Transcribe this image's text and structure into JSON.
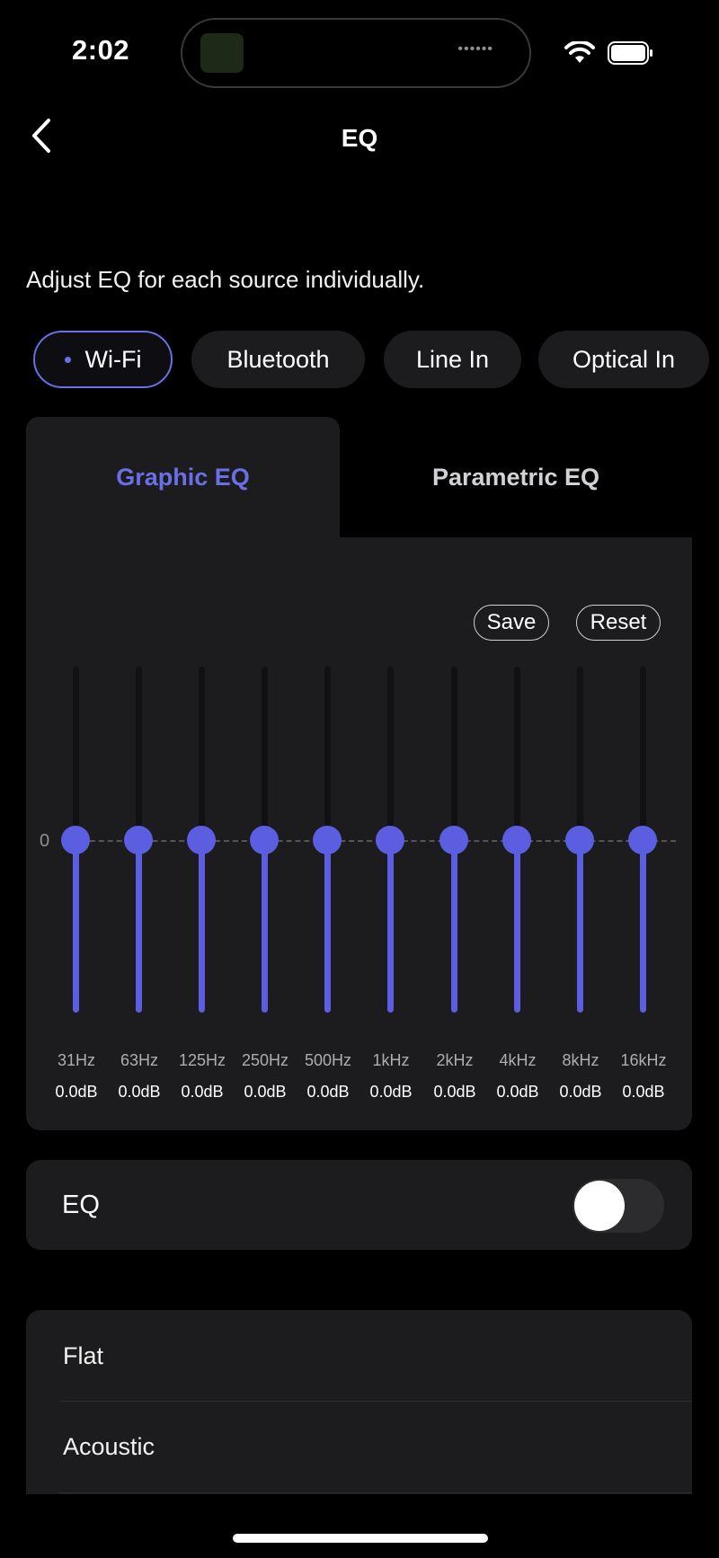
{
  "status_bar": {
    "time": "2:02"
  },
  "nav": {
    "title": "EQ"
  },
  "subtitle": "Adjust EQ for each source individually.",
  "sources": [
    {
      "label": "Wi-Fi",
      "selected": true
    },
    {
      "label": "Bluetooth",
      "selected": false
    },
    {
      "label": "Line In",
      "selected": false
    },
    {
      "label": "Optical In",
      "selected": false
    }
  ],
  "tabs": [
    {
      "label": "Graphic EQ",
      "selected": true
    },
    {
      "label": "Parametric EQ",
      "selected": false
    }
  ],
  "graphic_eq": {
    "save_label": "Save",
    "reset_label": "Reset",
    "zero_label": "0",
    "bands": [
      {
        "freq": "31Hz",
        "gain": "0.0dB"
      },
      {
        "freq": "63Hz",
        "gain": "0.0dB"
      },
      {
        "freq": "125Hz",
        "gain": "0.0dB"
      },
      {
        "freq": "250Hz",
        "gain": "0.0dB"
      },
      {
        "freq": "500Hz",
        "gain": "0.0dB"
      },
      {
        "freq": "1kHz",
        "gain": "0.0dB"
      },
      {
        "freq": "2kHz",
        "gain": "0.0dB"
      },
      {
        "freq": "4kHz",
        "gain": "0.0dB"
      },
      {
        "freq": "8kHz",
        "gain": "0.0dB"
      },
      {
        "freq": "16kHz",
        "gain": "0.0dB"
      }
    ]
  },
  "eq_toggle": {
    "label": "EQ",
    "on": false
  },
  "presets": [
    {
      "label": "Flat"
    },
    {
      "label": "Acoustic"
    }
  ],
  "colors": {
    "accent": "#5b5ee0",
    "background": "#000000",
    "card": "#1c1c1e"
  }
}
